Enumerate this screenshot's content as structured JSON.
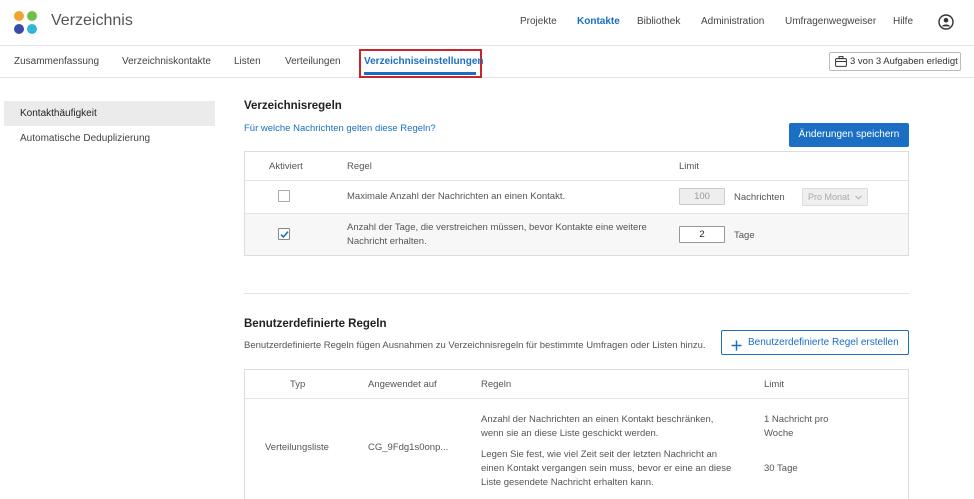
{
  "header": {
    "title": "Verzeichnis",
    "nav": [
      {
        "label": "Projekte",
        "active": false
      },
      {
        "label": "Kontakte",
        "active": true
      },
      {
        "label": "Bibliothek",
        "active": false
      },
      {
        "label": "Administration",
        "active": false
      },
      {
        "label": "Umfragenwegweiser",
        "active": false
      },
      {
        "label": "Hilfe",
        "active": false
      }
    ],
    "logo_colors": [
      "#f2a22e",
      "#6fbf4a",
      "#3e4aa8",
      "#2fb8d6"
    ],
    "user_icon": "user-circle-icon"
  },
  "subnav": {
    "tabs": [
      {
        "label": "Zusammenfassung"
      },
      {
        "label": "Verzeichniskontakte"
      },
      {
        "label": "Listen"
      },
      {
        "label": "Verteilungen"
      },
      {
        "label": "Verzeichniseinstellungen",
        "active": true
      }
    ],
    "tasks_label": "3 von 3 Aufgaben erledigt",
    "tasks_icon": "briefcase-icon"
  },
  "sidebar": {
    "items": [
      {
        "label": "Kontakthäufigkeit",
        "active": true
      },
      {
        "label": "Automatische Deduplizierung",
        "active": false
      }
    ]
  },
  "directory_rules": {
    "title": "Verzeichnisregeln",
    "help_link": "Für welche Nachrichten gelten diese Regeln?",
    "save_label": "Änderungen speichern",
    "columns": [
      "Aktiviert",
      "Regel",
      "Limit"
    ],
    "rows": [
      {
        "enabled": false,
        "rule": "Maximale Anzahl der Nachrichten an einen Kontakt.",
        "limit_value": "100",
        "limit_unit": "Nachrichten",
        "period": "Pro Monat"
      },
      {
        "enabled": true,
        "rule_line1": "Anzahl der Tage, die verstreichen müssen, bevor Kontakte eine weitere",
        "rule_line2": "Nachricht erhalten.",
        "limit_value": "2",
        "limit_unit": "Tage"
      }
    ]
  },
  "custom_rules": {
    "title": "Benutzerdefinierte Regeln",
    "description": "Benutzerdefinierte Regeln fügen Ausnahmen zu Verzeichnisregeln für bestimmte Umfragen oder Listen hinzu.",
    "create_label": "Benutzerdefinierte Regel erstellen",
    "columns": [
      "Typ",
      "Angewendet auf",
      "Regeln",
      "Limit"
    ],
    "rows": [
      {
        "type": "Verteilungsliste",
        "applied_to": "CG_9Fdg1s0onp...",
        "rule1_line1": "Anzahl der Nachrichten an einen Kontakt beschränken,",
        "rule1_line2": "wenn sie an diese Liste geschickt werden.",
        "limit1_line1": "1 Nachricht pro",
        "limit1_line2": "Woche",
        "rule2_line1": "Legen Sie fest, wie viel Zeit seit der letzten Nachricht an",
        "rule2_line2": "einen Kontakt vergangen sein muss, bevor er eine an diese",
        "rule2_line3": "Liste gesendete Nachricht erhalten kann.",
        "limit2": "30 Tage"
      }
    ]
  },
  "colors": {
    "accent": "#1a6fc4",
    "highlight_border": "#c9252c"
  }
}
